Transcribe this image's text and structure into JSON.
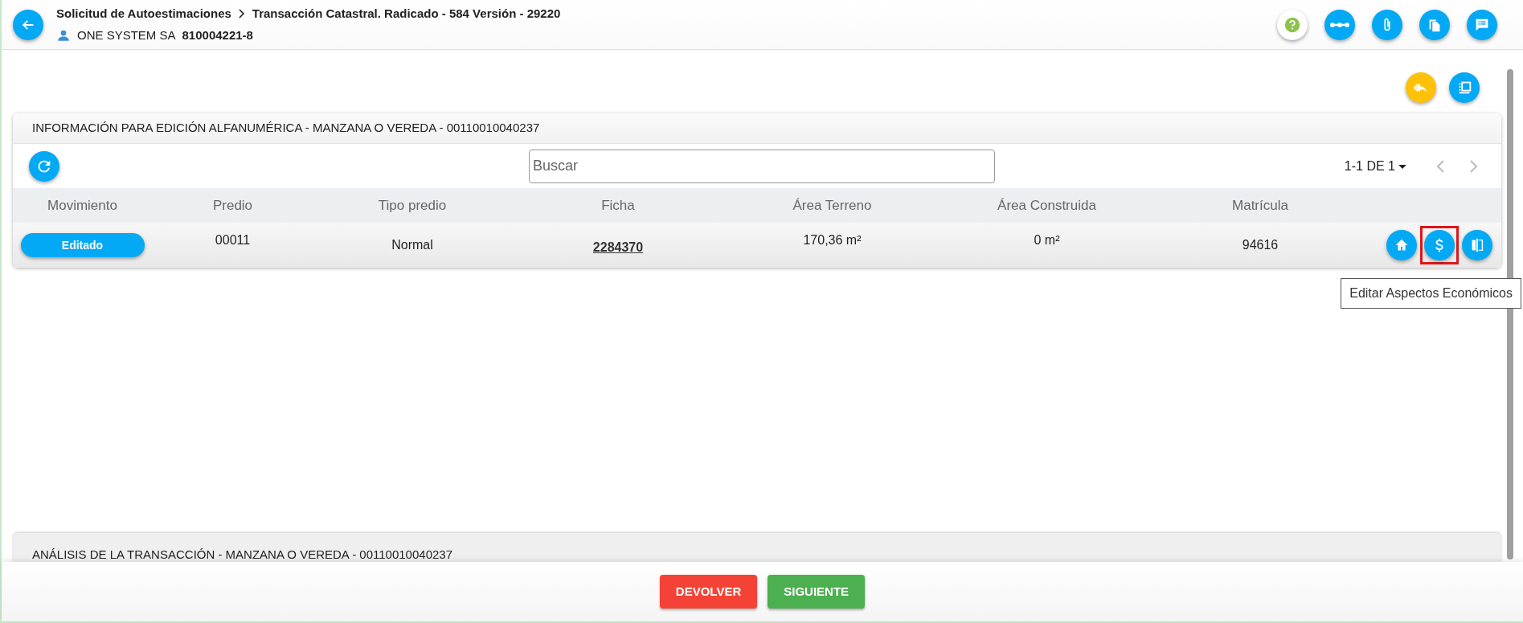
{
  "header": {
    "breadcrumb": [
      "Solicitud de Autoestimaciones",
      "Transacción Catastral. Radicado - 584 Versión - 29220"
    ],
    "user": {
      "name": "ONE SYSTEM SA",
      "nit": "810004221-8"
    }
  },
  "toolbar": [
    {
      "kind": "help"
    },
    {
      "kind": "flow"
    },
    {
      "kind": "attach"
    },
    {
      "kind": "copy"
    },
    {
      "kind": "notes"
    }
  ],
  "actions": [
    {
      "kind": "return"
    },
    {
      "kind": "select"
    }
  ],
  "panel": {
    "title": "INFORMACIÓN PARA EDICIÓN ALFANUMÉRICA - MANZANA O VEREDA - 00110010040237",
    "search": {
      "placeholder": "Buscar"
    },
    "pagination": "1-1 DE 1",
    "columns": [
      "Movimiento",
      "Predio",
      "Tipo predio",
      "Ficha",
      "Área Terreno",
      "Área Construida",
      "Matrícula"
    ],
    "rows": [
      {
        "movimiento": "Editado",
        "predio": "00011",
        "tipo_predio": "Normal",
        "ficha": "2284370",
        "area_terreno": "170,36 m²",
        "area_construida": "0 m²",
        "matricula": "94616",
        "row_actions": [
          {
            "kind": "home",
            "highlighted": false
          },
          {
            "kind": "money",
            "highlighted": true
          },
          {
            "kind": "compare",
            "highlighted": false
          }
        ]
      }
    ]
  },
  "tooltip": "Editar Aspectos Económicos",
  "second_panel": {
    "title": "ANÁLISIS DE LA TRANSACCIÓN - MANZANA O VEREDA - 00110010040237"
  },
  "footer_buttons": [
    {
      "label": "DEVOLVER",
      "kind": "danger"
    },
    {
      "label": "SIGUIENTE",
      "kind": "success"
    }
  ]
}
